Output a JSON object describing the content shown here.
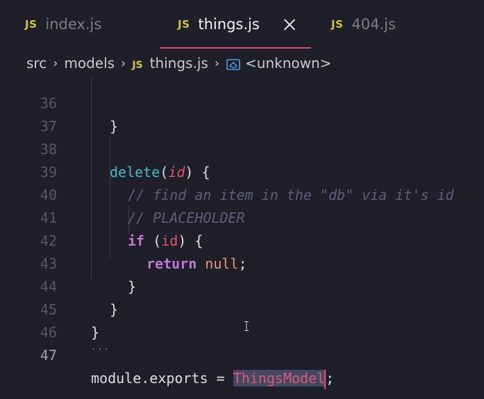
{
  "tabs": [
    {
      "icon": "JS",
      "label": "index.js",
      "active": false
    },
    {
      "icon": "JS",
      "label": "things.js",
      "active": true
    },
    {
      "icon": "JS",
      "label": "404.js",
      "active": false
    }
  ],
  "breadcrumb": {
    "items": [
      "src",
      "models",
      "things.js",
      "<unknown>"
    ],
    "file_icon": "JS",
    "symbol_icon": "symbol-method-icon"
  },
  "editor": {
    "lines": [
      {
        "num": "36",
        "text": "}"
      },
      {
        "num": "37",
        "text": ""
      },
      {
        "num": "38",
        "text": "delete(id) {"
      },
      {
        "num": "39",
        "text": "// find an item in the \"db\" via it's id"
      },
      {
        "num": "40",
        "text": "// PLACEHOLDER"
      },
      {
        "num": "41",
        "text": "if (id) {"
      },
      {
        "num": "42",
        "text": "return null;"
      },
      {
        "num": "43",
        "text": "}"
      },
      {
        "num": "44",
        "text": "}"
      },
      {
        "num": "45",
        "text": "}"
      },
      {
        "num": "46",
        "text": ""
      },
      {
        "num": "47",
        "text": "module.exports = ThingsModel;"
      }
    ],
    "tokens": {
      "delete": "delete",
      "id": "id",
      "comment1": "// find an item in the \"db\" via it's id",
      "comment2": "// PLACEHOLDER",
      "if": "if",
      "return": "return",
      "null": "null",
      "module_exports": "module.exports",
      "equals": " = ",
      "selected": "ThingsModel",
      "semicolon": ";",
      "ellipsis": "..."
    },
    "current_line": "47"
  },
  "colors": {
    "background": "#1e1f29",
    "tab_underline": "#d24a6a",
    "js_badge": "#d3c34a",
    "function": "#4db5c7",
    "param": "#e0536e",
    "keyword": "#c377d8",
    "comment": "#5d6076",
    "null": "#e59a74",
    "selection": "#464862"
  }
}
